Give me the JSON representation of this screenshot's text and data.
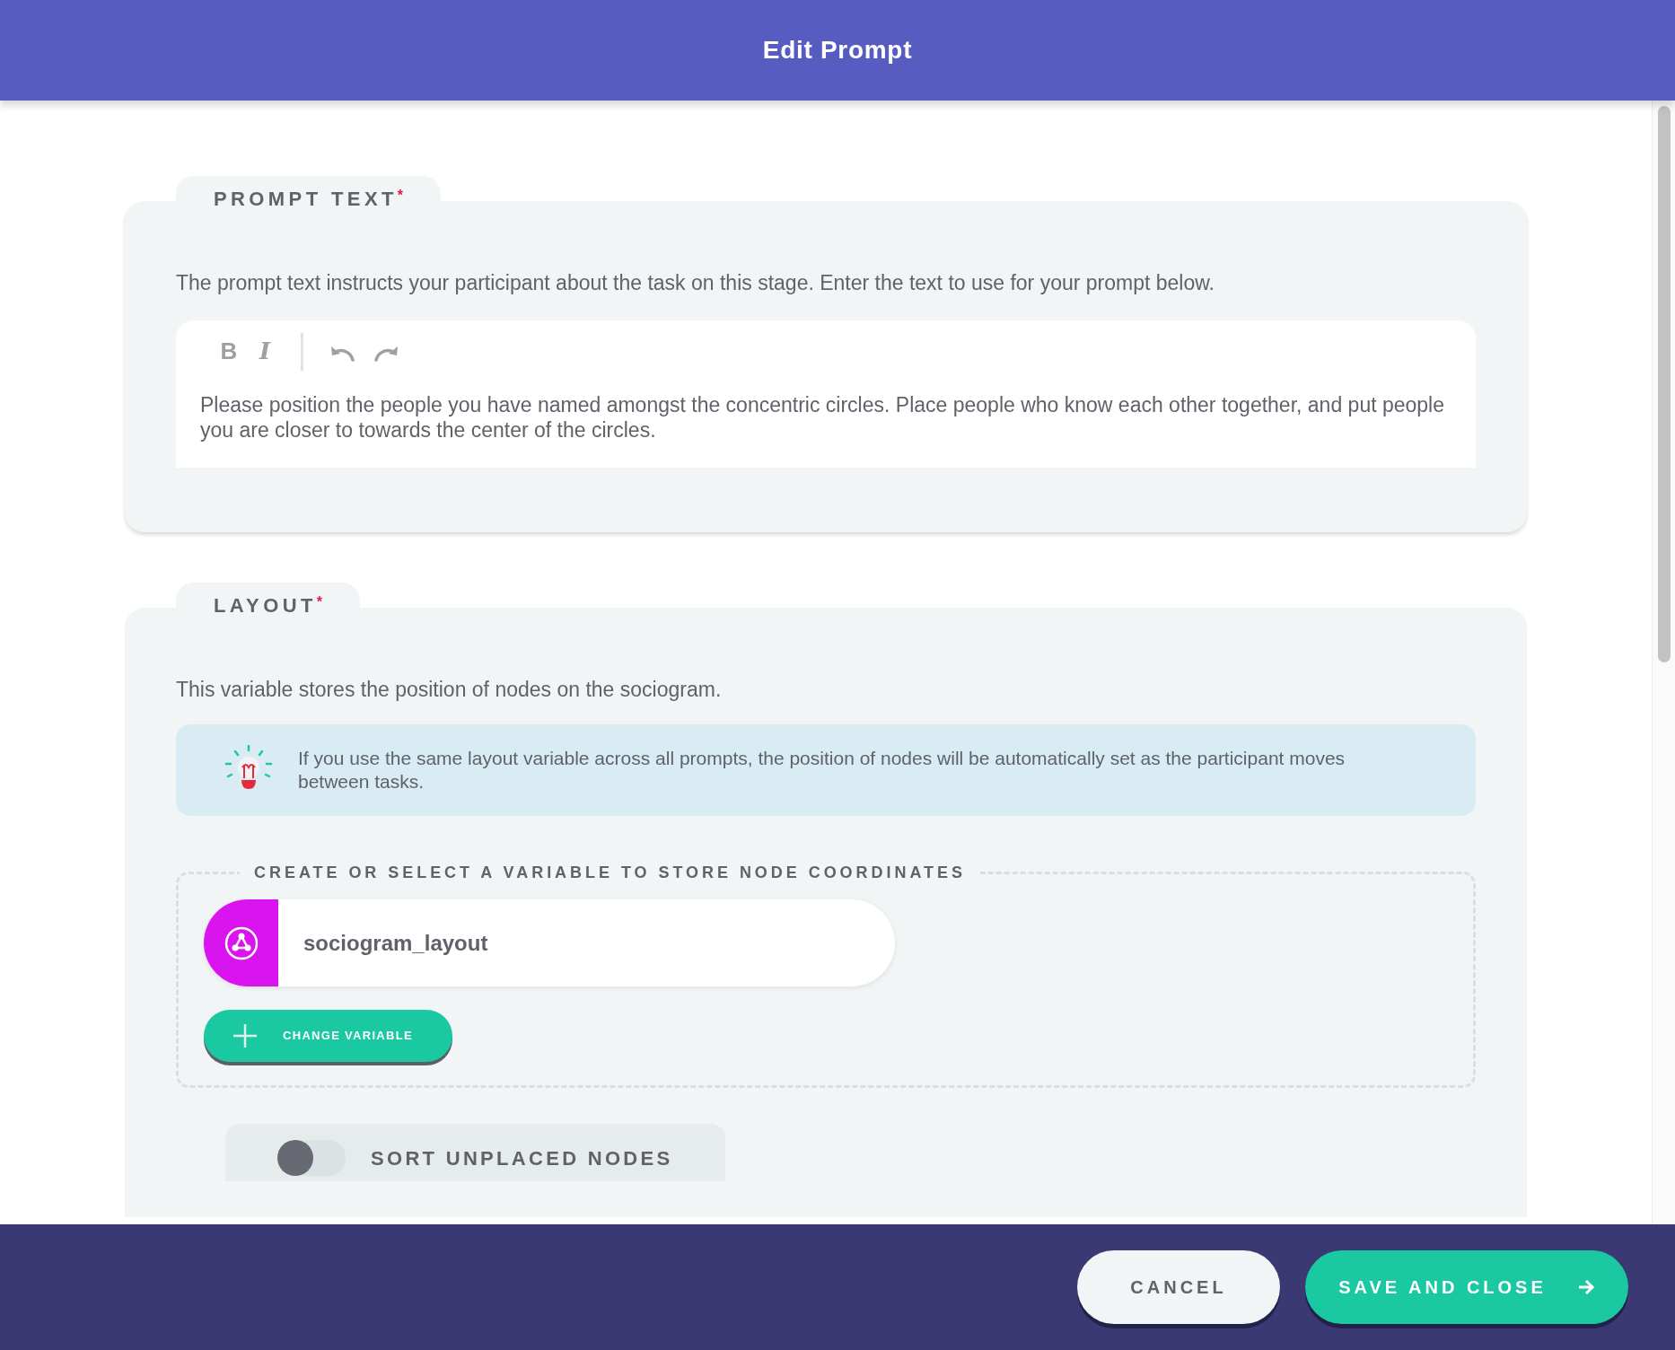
{
  "window": {
    "title": "Edit Prompt"
  },
  "prompt_section": {
    "title": "PROMPT TEXT",
    "required_mark": "*",
    "description": "The prompt text instructs your participant about the task on this stage. Enter the text to use for your prompt below.",
    "toolbar": [
      {
        "kind": "bold",
        "label": "B"
      },
      {
        "kind": "italic",
        "label": "I"
      },
      {
        "kind": "divider"
      },
      {
        "kind": "undo"
      },
      {
        "kind": "redo"
      }
    ],
    "value": "Please position the people you have named amongst the concentric circles. Place people who know each other together, and put people you are closer to towards the center of the circles."
  },
  "layout_section": {
    "title": "LAYOUT",
    "required_mark": "*",
    "description": "This variable stores the position of nodes on the sociogram.",
    "tip": "If you use the same layout variable across all prompts, the position of nodes will be automatically set as the participant moves between tasks.",
    "fieldset_label": "CREATE OR SELECT A VARIABLE TO STORE NODE COORDINATES",
    "variable": {
      "name": "sociogram_layout",
      "color": "#d914ee"
    },
    "change_button": "CHANGE VARIABLE"
  },
  "sort_toggle": {
    "label": "SORT UNPLACED NODES",
    "on": false
  },
  "footer": {
    "buttons": [
      {
        "label": "CANCEL",
        "kind": "secondary"
      },
      {
        "label": "SAVE AND CLOSE",
        "kind": "primary"
      }
    ]
  }
}
